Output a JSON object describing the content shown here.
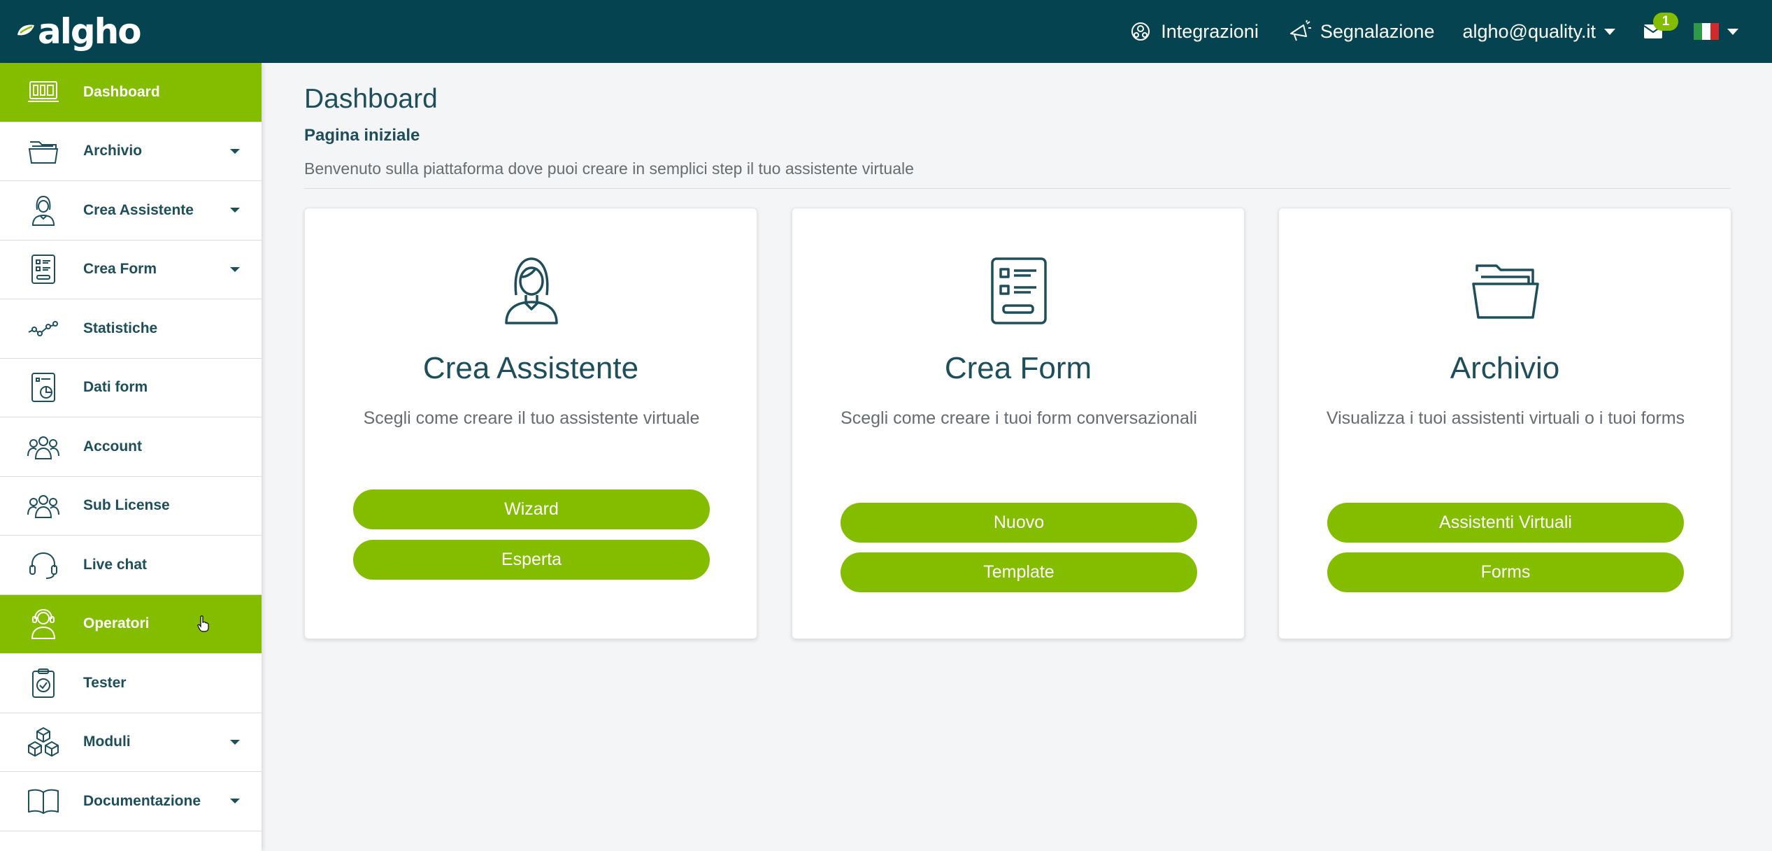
{
  "brand": {
    "name": "algho",
    "accent": "#84bd00",
    "header_bg": "#064350",
    "text": "#1d4e5a"
  },
  "topnav": {
    "integrazioni": {
      "label": "Integrazioni",
      "icon": "integrations-icon"
    },
    "segnalazione": {
      "label": "Segnalazione",
      "icon": "megaphone-icon"
    },
    "user": {
      "label": "algho@quality.it"
    },
    "mail": {
      "icon": "mail-icon",
      "badge": "1"
    },
    "language": {
      "icon": "italy-flag-icon"
    }
  },
  "sidebar": {
    "items": [
      {
        "label": "Dashboard",
        "icon": "dashboard-icon",
        "active": true
      },
      {
        "label": "Archivio",
        "icon": "folder-icon",
        "dropdown": true
      },
      {
        "label": "Crea Assistente",
        "icon": "assistant-icon",
        "dropdown": true
      },
      {
        "label": "Crea Form",
        "icon": "form-icon",
        "dropdown": true
      },
      {
        "label": "Statistiche",
        "icon": "stats-icon"
      },
      {
        "label": "Dati form",
        "icon": "form-data-icon"
      },
      {
        "label": "Account",
        "icon": "users-icon"
      },
      {
        "label": "Sub License",
        "icon": "users-icon"
      },
      {
        "label": "Live chat",
        "icon": "headset-icon"
      },
      {
        "label": "Operatori",
        "icon": "operator-icon",
        "active": true
      },
      {
        "label": "Tester",
        "icon": "clipboard-check-icon"
      },
      {
        "label": "Moduli",
        "icon": "cubes-icon",
        "dropdown": true
      },
      {
        "label": "Documentazione",
        "icon": "book-icon",
        "dropdown": true
      }
    ]
  },
  "main": {
    "title": "Dashboard",
    "subtitle": "Pagina iniziale",
    "description": "Benvenuto sulla piattaforma dove puoi creare in semplici step il tuo assistente virtuale",
    "cards": [
      {
        "title": "Crea Assistente",
        "description": "Scegli come creare il tuo assistente virtuale",
        "icon": "assistant-icon",
        "buttons": [
          "Wizard",
          "Esperta"
        ]
      },
      {
        "title": "Crea Form",
        "description": "Scegli come creare i tuoi form conversazionali",
        "icon": "form-icon",
        "buttons": [
          "Nuovo",
          "Template"
        ]
      },
      {
        "title": "Archivio",
        "description": "Visualizza i tuoi assistenti virtuali o i tuoi forms",
        "icon": "folder-icon",
        "buttons": [
          "Assistenti Virtuali",
          "Forms"
        ]
      }
    ]
  }
}
